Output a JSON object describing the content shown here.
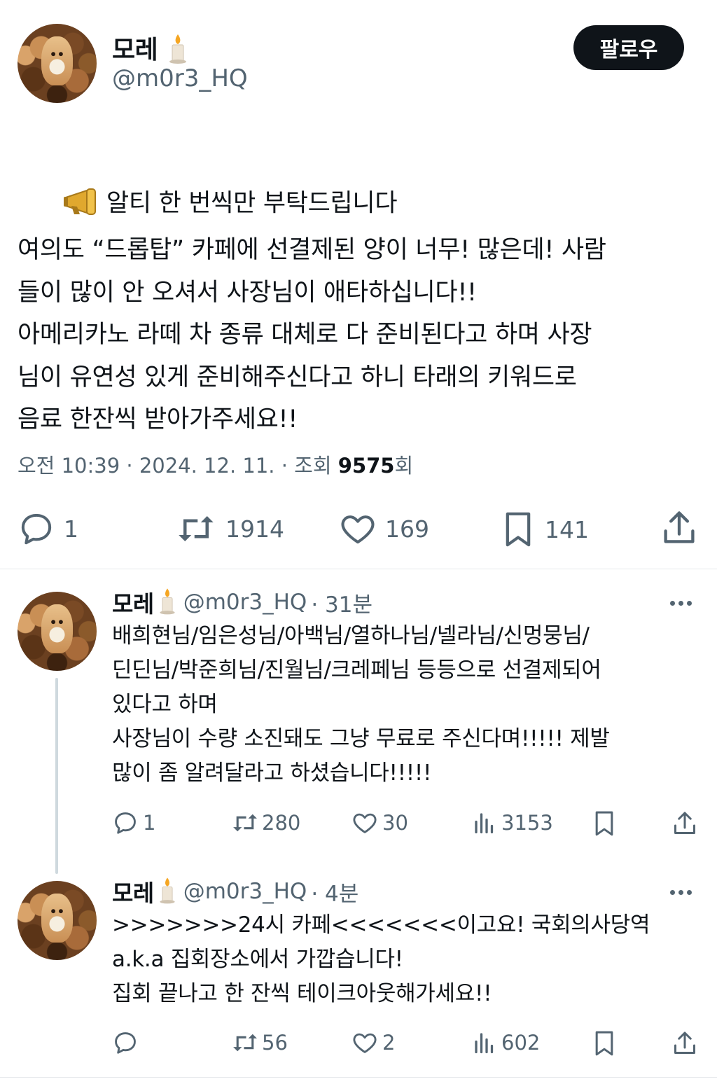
{
  "main_tweet": {
    "author_name": "모레",
    "handle": "@m0r3_HQ",
    "follow_label": "팔로우",
    "text_lines": [
      "알티 한 번씩만 부탁드립니다",
      "여의도 “드롭탑” 카페에 선결제된 양이 너무! 많은데! 사람",
      "들이 많이 안 오셔서 사장님이 애타하십니다!!",
      "아메리카노 라떼 차 종류 대체로 다 준비된다고 하며 사장",
      "님이 유연성 있게 준비해주신다고 하니 타래의 키워드로",
      "음료 한잔씩 받아가주세요!!"
    ],
    "time": "오전 10:39",
    "date": "2024. 12. 11.",
    "views_prefix": "조회",
    "views_count": "9575",
    "views_suffix": "회",
    "separator": "·",
    "replies": "1",
    "retweets": "1914",
    "likes": "169",
    "bookmarks": "141"
  },
  "replies": [
    {
      "author_name": "모레",
      "handle": "@m0r3_HQ",
      "time_ago": "· 31분",
      "text_lines": [
        "배희현님/임은성님/아백님/열하나님/넬라님/신멍뭉님/",
        "딘딘님/박준희님/진월님/크레페님 등등으로 선결제되어",
        "있다고 하며",
        "사장님이 수량 소진돼도 그냥 무료로 주신다며!!!!! 제발",
        "많이 좀 알려달라고 하셨습니다!!!!!"
      ],
      "replies": "1",
      "retweets": "280",
      "likes": "30",
      "views": "3153"
    },
    {
      "author_name": "모레",
      "handle": "@m0r3_HQ",
      "time_ago": "· 4분",
      "text_lines": [
        ">>>>>>>24시 카페<<<<<<<이고요! 국회의사당역",
        "a.k.a 집회장소에서 가깝습니다!",
        "집회 끝나고 한 잔씩 테이크아웃해가세요!!"
      ],
      "replies": "",
      "retweets": "56",
      "likes": "2",
      "views": "602"
    }
  ],
  "icons": {
    "name_badge": "candle-icon",
    "tweet_prefix": "megaphone-icon",
    "reply": "reply-icon",
    "retweet": "retweet-icon",
    "like": "heart-icon",
    "bookmark": "bookmark-icon",
    "share": "share-icon",
    "views": "views-icon",
    "more": "more-icon"
  },
  "colors": {
    "text": "#0f1419",
    "secondary": "#536471",
    "follow_bg": "#0f1419",
    "divider": "#e6e9ec"
  }
}
